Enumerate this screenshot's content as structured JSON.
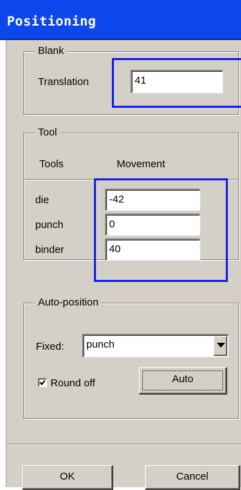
{
  "window": {
    "title": "Positioning"
  },
  "blank": {
    "group_title": "Blank",
    "translation_label": "Translation",
    "translation_value": "41"
  },
  "tool": {
    "group_title": "Tool",
    "col_tools": "Tools",
    "col_movement": "Movement",
    "rows": [
      {
        "name": "die",
        "value": "-42"
      },
      {
        "name": "punch",
        "value": "0"
      },
      {
        "name": "binder",
        "value": "40"
      }
    ]
  },
  "auto_position": {
    "group_title": "Auto-position",
    "fixed_label": "Fixed:",
    "fixed_value": "punch",
    "round_off_label": "Round off",
    "round_off_checked": true,
    "auto_label": "Auto"
  },
  "buttons": {
    "ok": "OK",
    "cancel": "Cancel"
  },
  "colors": {
    "titlebar": "#0c46ec",
    "highlight": "#1620e8",
    "face": "#d4d0c8"
  },
  "icons": {
    "dropdown": "chevron-down-icon",
    "checkbox": "check-icon"
  }
}
